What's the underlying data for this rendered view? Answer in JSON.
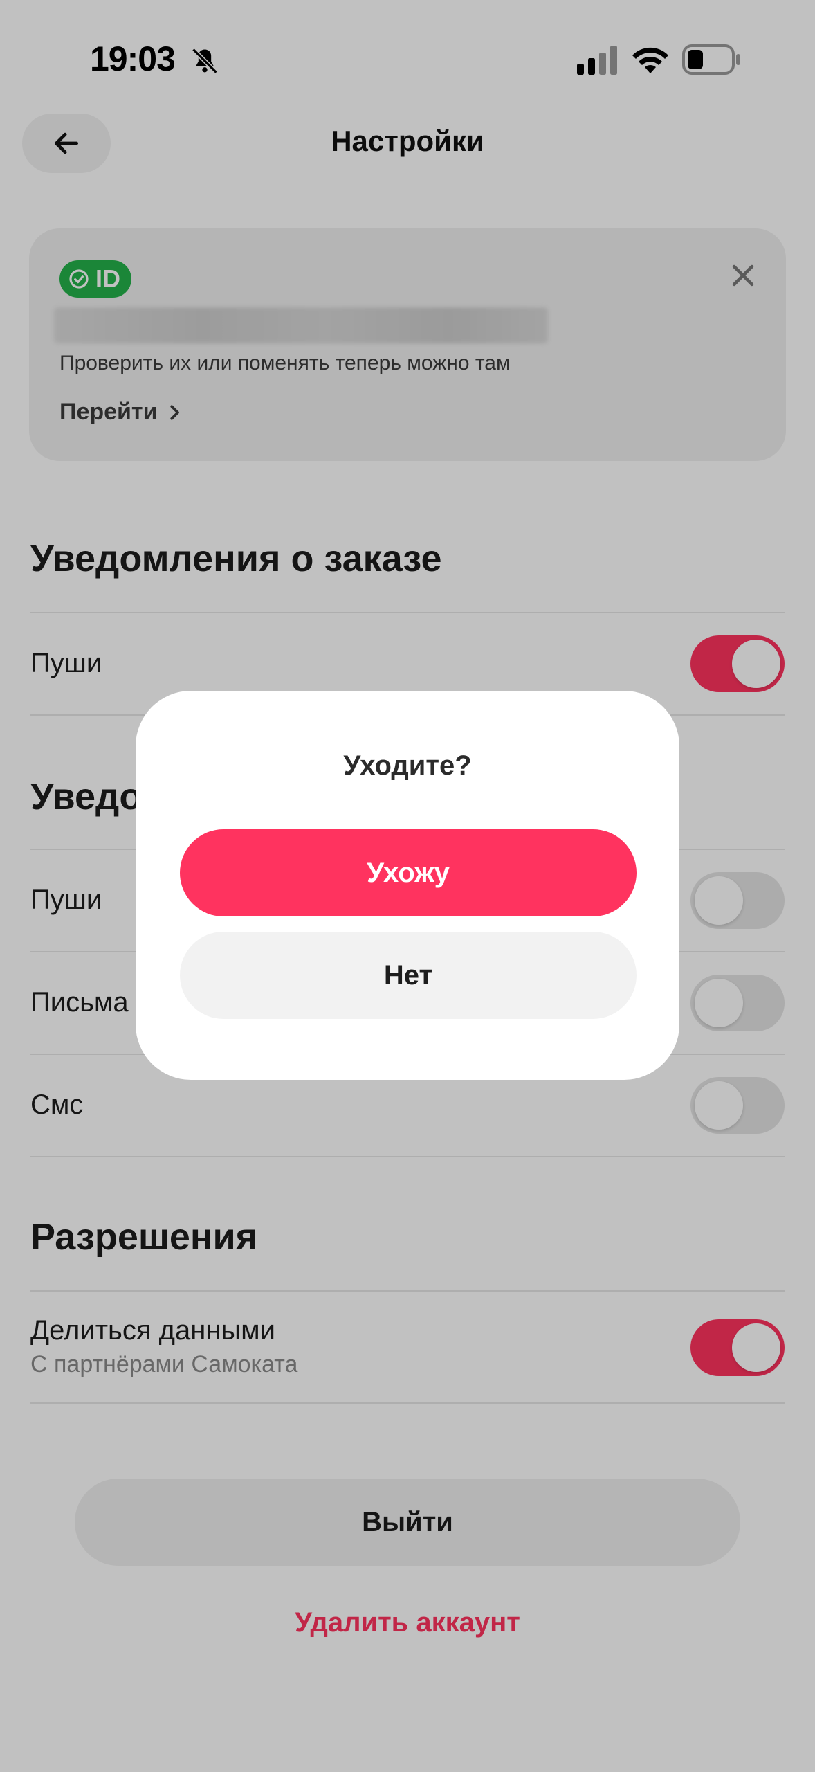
{
  "status_bar": {
    "time": "19:03",
    "icons": [
      "bell-off-icon",
      "cellular-signal-icon",
      "wifi-icon",
      "battery-icon"
    ]
  },
  "header": {
    "title": "Настройки",
    "back_icon": "arrow-left-icon"
  },
  "id_card": {
    "badge_label": "ID",
    "description": "Проверить их или поменять теперь можно там",
    "link_label": "Перейти",
    "close_icon": "close-icon"
  },
  "order_notifications": {
    "title": "Уведомления о заказе",
    "items": [
      {
        "label": "Пуши",
        "enabled": true
      }
    ]
  },
  "notifications": {
    "title": "Уведо",
    "items": [
      {
        "label": "Пуши",
        "enabled": false
      },
      {
        "label": "Письма",
        "enabled": false
      },
      {
        "label": "Смс",
        "enabled": false
      }
    ]
  },
  "permissions": {
    "title": "Разрешения",
    "items": [
      {
        "label": "Делиться данными",
        "sublabel": "С партнёрами Самоката",
        "enabled": true
      }
    ]
  },
  "footer": {
    "logout_label": "Выйти",
    "delete_label": "Удалить аккаунт"
  },
  "dialog": {
    "title": "Уходите?",
    "confirm_label": "Ухожу",
    "cancel_label": "Нет"
  },
  "colors": {
    "accent": "#ff335f",
    "id_badge": "#24b24a",
    "overlay": "rgba(0,0,0,0.245)"
  }
}
